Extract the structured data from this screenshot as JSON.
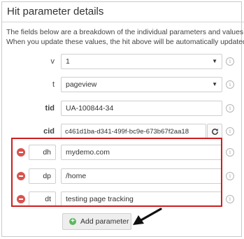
{
  "panel": {
    "title": "Hit parameter details",
    "description_line1": "The fields below are a breakdown of the individual parameters and values for",
    "description_line2": "When you update these values, the hit above will be automatically updated."
  },
  "params": {
    "v": {
      "label": "v",
      "value": "1"
    },
    "t": {
      "label": "t",
      "value": "pageview"
    },
    "tid": {
      "label": "tid",
      "value": "UA-100844-34"
    },
    "cid": {
      "label": "cid",
      "value": "c461d1ba-d341-499f-bc9e-673b67f2aa18"
    }
  },
  "custom_params": [
    {
      "name": "dh",
      "value": "mydemo.com"
    },
    {
      "name": "dp",
      "value": "/home"
    },
    {
      "name": "dt",
      "value": "testing page tracking"
    }
  ],
  "add_button_label": "Add parameter",
  "icons": {
    "info": "info-icon",
    "refresh": "refresh-icon",
    "remove": "remove-icon",
    "add": "plus-icon",
    "dropdown": "chevron-down-icon",
    "pointer": "arrow-icon"
  },
  "colors": {
    "highlight_border": "#cc1f1f",
    "remove_button": "#d9534f",
    "add_icon": "#5cb85c"
  }
}
